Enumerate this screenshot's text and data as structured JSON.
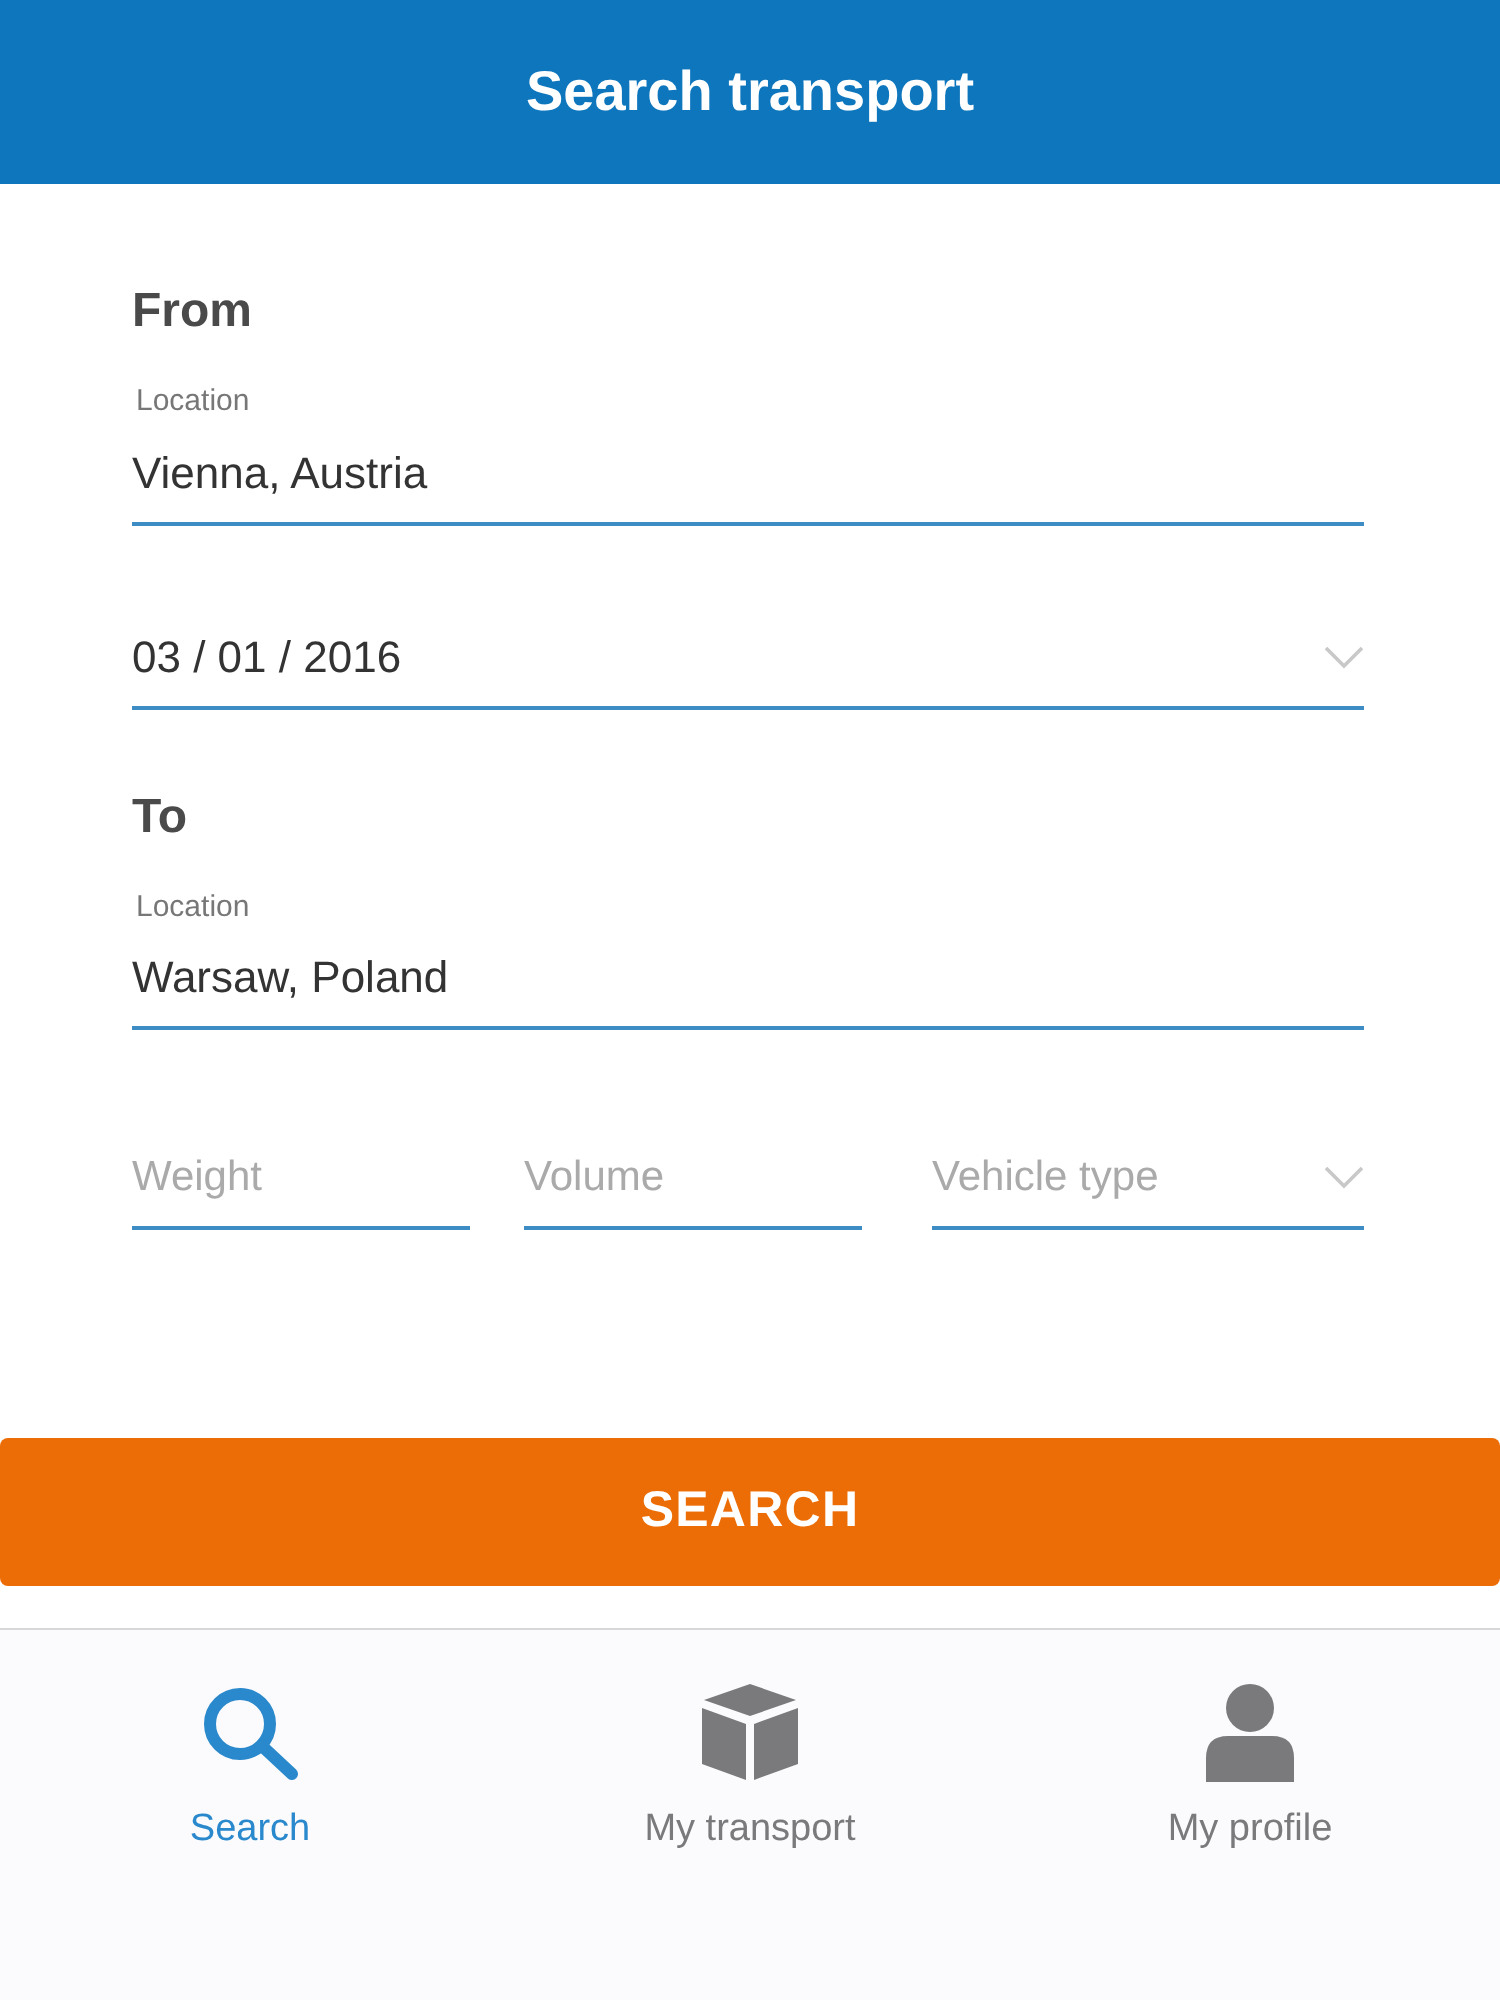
{
  "header": {
    "title": "Search transport"
  },
  "sections": [
    {
      "heading": "From",
      "fields": [
        {
          "kind": "text",
          "label": "Location",
          "value": "Vienna, Austria"
        },
        {
          "kind": "select",
          "value": "03 / 01 / 2016"
        }
      ]
    },
    {
      "heading": "To",
      "fields": [
        {
          "kind": "text",
          "label": "Location",
          "value": "Warsaw, Poland"
        }
      ]
    }
  ],
  "filters": [
    {
      "kind": "input",
      "placeholder": "Weight"
    },
    {
      "kind": "input",
      "placeholder": "Volume"
    },
    {
      "kind": "select",
      "placeholder": "Vehicle type"
    }
  ],
  "search_button": "SEARCH",
  "tabs": [
    {
      "kind": "search",
      "label": "Search",
      "selected": true
    },
    {
      "kind": "box",
      "label": "My transport",
      "selected": false
    },
    {
      "kind": "person",
      "label": "My profile",
      "selected": false
    }
  ]
}
